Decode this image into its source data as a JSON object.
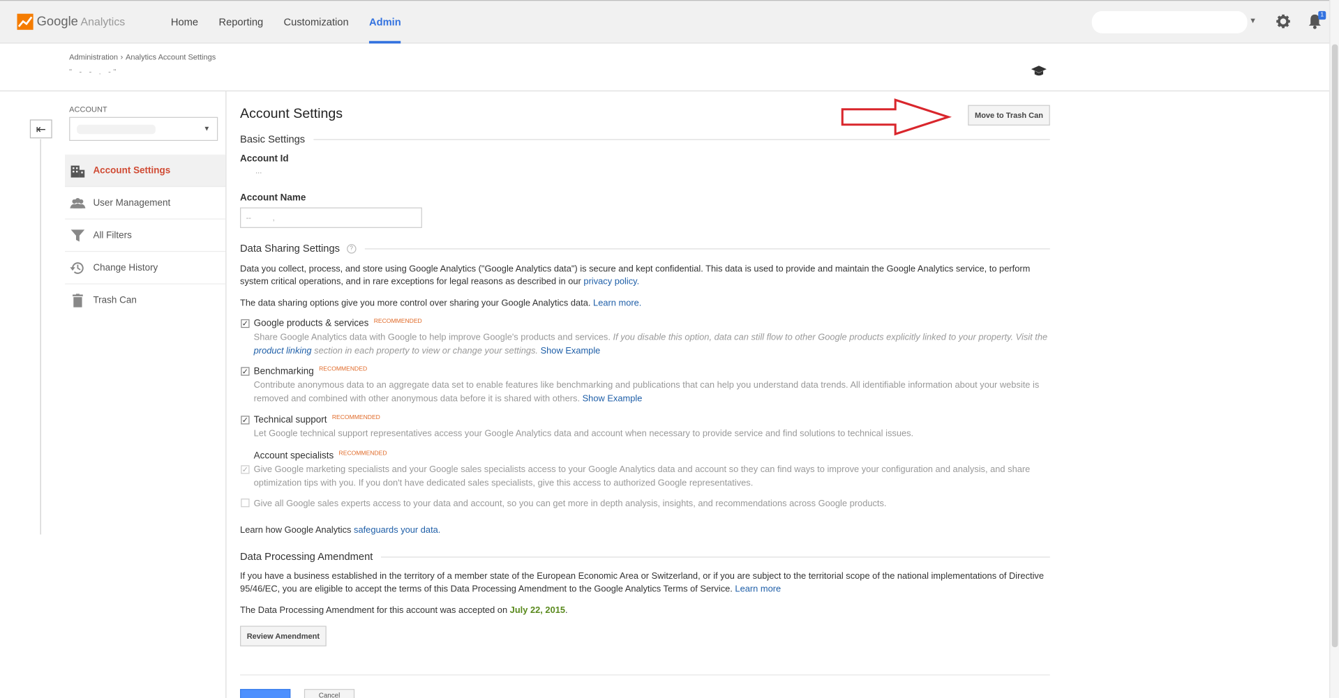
{
  "topbar": {
    "logo_google": "Google",
    "logo_analytics": "Analytics",
    "nav": [
      {
        "label": "Home",
        "active": false
      },
      {
        "label": "Reporting",
        "active": false
      },
      {
        "label": "Customization",
        "active": false
      },
      {
        "label": "Admin",
        "active": true
      }
    ],
    "notification_badge": "1"
  },
  "breadcrumb": {
    "items": [
      "Administration",
      "Analytics Account Settings"
    ],
    "separator": "›",
    "sub": "\"  -  -     .            -\""
  },
  "sidebar": {
    "account_label": "ACCOUNT",
    "items": [
      {
        "label": "Account Settings",
        "icon": "building-icon",
        "active": true
      },
      {
        "label": "User Management",
        "icon": "users-icon",
        "active": false
      },
      {
        "label": "All Filters",
        "icon": "filter-icon",
        "active": false
      },
      {
        "label": "Change History",
        "icon": "history-icon",
        "active": false
      },
      {
        "label": "Trash Can",
        "icon": "trash-icon",
        "active": false
      }
    ]
  },
  "main": {
    "title": "Account Settings",
    "trash_button": "Move to Trash Can",
    "basic_settings": "Basic Settings",
    "account_id_label": "Account Id",
    "account_id_value": "...",
    "account_name_label": "Account Name",
    "account_name_value": "--          ,",
    "data_sharing_title": "Data Sharing Settings",
    "help": "?",
    "intro1": "Data you collect, process, and store using Google Analytics (\"Google Analytics data\") is secure and kept confidential. This data is used to provide and maintain the Google Analytics service, to perform system critical operations, and in rare exceptions for legal reasons as described in our",
    "privacy_link": "privacy policy.",
    "intro2": "The data sharing options give you more control over sharing your Google Analytics data.",
    "learn_more": "Learn more.",
    "recommended": "RECOMMENDED",
    "options": [
      {
        "title": "Google products & services",
        "desc": "Share Google Analytics data with Google to help improve Google's products and services.",
        "desc_italic": "If you disable this option, data can still flow to other Google products explicitly linked to your property. Visit the",
        "link_italic": "product linking",
        "desc_italic2": "section in each property to view or change your settings.",
        "show_example": "Show Example"
      },
      {
        "title": "Benchmarking",
        "desc": "Contribute anonymous data to an aggregate data set to enable features like benchmarking and publications that can help you understand data trends. All identifiable information about your website is removed and combined with other anonymous data before it is shared with others.",
        "show_example": "Show Example"
      },
      {
        "title": "Technical support",
        "desc": "Let Google technical support representatives access your Google Analytics data and account when necessary to provide service and find solutions to technical issues."
      },
      {
        "title": "Account specialists",
        "desc": "Give Google marketing specialists and your Google sales specialists access to your Google Analytics data and account so they can find ways to improve your configuration and analysis, and share optimization tips with you. If you don't have dedicated sales specialists, give this access to authorized Google representatives."
      }
    ],
    "sales_experts": "Give all Google sales experts access to your data and account, so you can get more in depth analysis, insights, and recommendations across Google products.",
    "safeguards_pre": "Learn how Google Analytics",
    "safeguards_link": "safeguards your data.",
    "dpa_title": "Data Processing Amendment",
    "dpa_text": "If you have a business established in the territory of a member state of the European Economic Area or Switzerland, or if you are subject to the territorial scope of the national implementations of Directive 95/46/EC, you are eligible to accept the terms of this Data Processing Amendment to the Google Analytics Terms of Service.",
    "dpa_learn_more": "Learn more",
    "dpa_accepted_pre": "The Data Processing Amendment for this account was accepted on",
    "dpa_date": "July 22, 2015",
    "dpa_period": ".",
    "review_button": "Review Amendment",
    "cancel_button": "Cancel"
  },
  "colors": {
    "accent": "#3372df",
    "active_side": "#d04b34",
    "arrow": "#d9262c",
    "recommended": "#e06a28",
    "date": "#5a8a1e"
  }
}
